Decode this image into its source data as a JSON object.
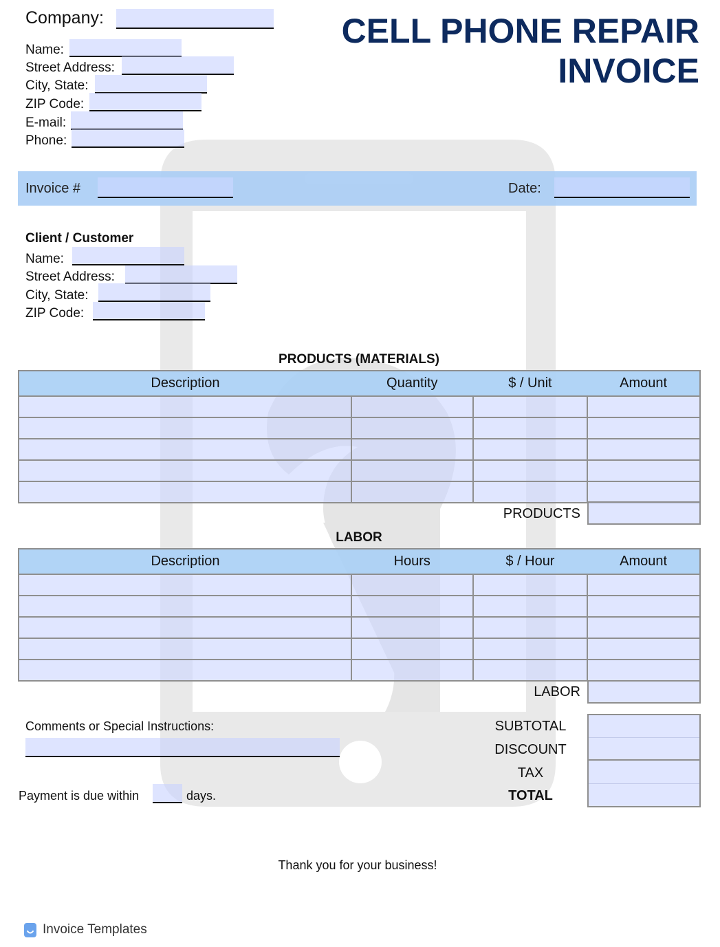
{
  "header": {
    "company_label": "Company:",
    "title_line1": "CELL PHONE REPAIR",
    "title_line2": "INVOICE",
    "title_color": "#0d2a5e",
    "sender_fields": [
      {
        "label": "Name:",
        "value": ""
      },
      {
        "label": "Street Address:",
        "value": ""
      },
      {
        "label": "City, State:",
        "value": ""
      },
      {
        "label": "ZIP Code:",
        "value": ""
      },
      {
        "label": "E-mail:",
        "value": ""
      },
      {
        "label": "Phone:",
        "value": ""
      }
    ]
  },
  "invoice_bar": {
    "invoice_label": "Invoice #",
    "invoice_value": "",
    "date_label": "Date:",
    "date_value": "",
    "band_color": "#aacdf5"
  },
  "client": {
    "heading": "Client / Customer",
    "fields": [
      {
        "label": "Name:",
        "value": ""
      },
      {
        "label": "Street Address:",
        "value": ""
      },
      {
        "label": "City, State:",
        "value": ""
      },
      {
        "label": "ZIP Code:",
        "value": ""
      }
    ]
  },
  "products": {
    "heading": "PRODUCTS (MATERIALS)",
    "columns": [
      "Description",
      "Quantity",
      "$ / Unit",
      "Amount"
    ],
    "rows": [
      [
        "",
        "",
        "",
        ""
      ],
      [
        "",
        "",
        "",
        ""
      ],
      [
        "",
        "",
        "",
        ""
      ],
      [
        "",
        "",
        "",
        ""
      ],
      [
        "",
        "",
        "",
        ""
      ]
    ],
    "total_label": "PRODUCTS",
    "total_value": ""
  },
  "labor": {
    "heading": "LABOR",
    "columns": [
      "Description",
      "Hours",
      "$ / Hour",
      "Amount"
    ],
    "rows": [
      [
        "",
        "",
        "",
        ""
      ],
      [
        "",
        "",
        "",
        ""
      ],
      [
        "",
        "",
        "",
        ""
      ],
      [
        "",
        "",
        "",
        ""
      ],
      [
        "",
        "",
        "",
        ""
      ]
    ],
    "total_label": "LABOR",
    "total_value": ""
  },
  "comments": {
    "label": "Comments or Special Instructions:",
    "value": ""
  },
  "payment": {
    "prefix": "Payment is due within",
    "days_value": "",
    "suffix": "days."
  },
  "summary": [
    {
      "label": "SUBTOTAL",
      "value": "",
      "bold": false
    },
    {
      "label": "DISCOUNT",
      "value": "",
      "bold": false
    },
    {
      "label": "TAX",
      "value": "",
      "bold": false
    },
    {
      "label": "TOTAL",
      "value": "",
      "bold": true
    }
  ],
  "footer": {
    "thanks": "Thank you for your business!",
    "brand": "Invoice Templates",
    "brand_icon": "invoice-templates-logo-icon"
  }
}
